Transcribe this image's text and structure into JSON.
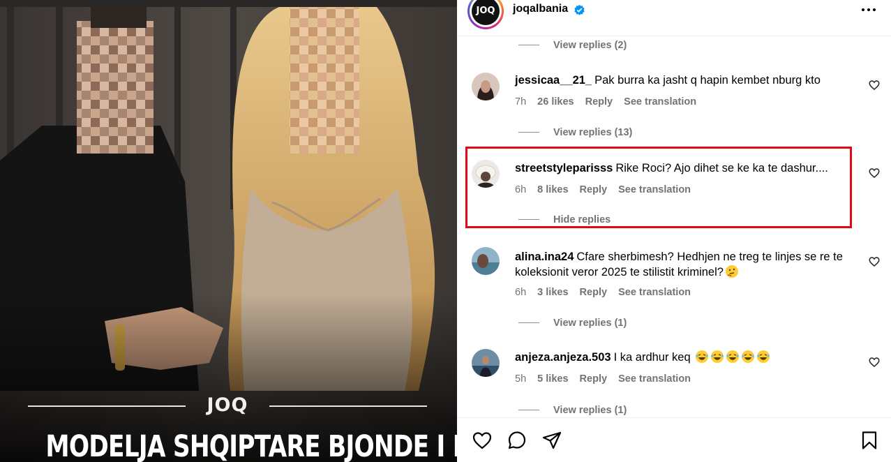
{
  "post": {
    "media_logo": "JOQ",
    "media_headline": "MODELJA SHQIPTARE BJONDE I BËN"
  },
  "header": {
    "avatar_logo": "JOQ",
    "username": "joqalbania",
    "verified": true,
    "more_icon": "more-horizontal-icon"
  },
  "comments": [
    {
      "view_replies_above": "View replies (2)"
    },
    {
      "username": "jessicaa__21_",
      "text": "Pak burra ka jasht q hapin kembet nburg kto",
      "time": "7h",
      "likes": "26 likes",
      "reply": "Reply",
      "translate": "See translation",
      "replies_toggle": "View replies (13)"
    },
    {
      "username": "streetstyleparisss",
      "text": "Rike Roci? Ajo dihet se ke ka te dashur....",
      "time": "6h",
      "likes": "8 likes",
      "reply": "Reply",
      "translate": "See translation",
      "replies_toggle": "Hide replies",
      "highlighted": true
    },
    {
      "username": "alina.ina24",
      "text": "Cfare sherbimesh? Hedhjen ne treg te linjes se re te koleksionit veror 2025 te stilistit kriminel?",
      "time": "6h",
      "likes": "3 likes",
      "reply": "Reply",
      "translate": "See translation",
      "replies_toggle": "View replies (1)"
    },
    {
      "username": "anjeza.anjeza.503",
      "text": "I ka ardhur keq",
      "time": "5h",
      "likes": "5 likes",
      "reply": "Reply",
      "translate": "See translation",
      "replies_toggle": "View replies (1)"
    }
  ],
  "actions": {
    "like_icon": "heart-icon",
    "comment_icon": "comment-icon",
    "share_icon": "send-icon",
    "save_icon": "bookmark-icon"
  },
  "colors": {
    "highlight_border": "#e30613",
    "verified_blue": "#0095f6",
    "muted_text": "#737373"
  }
}
